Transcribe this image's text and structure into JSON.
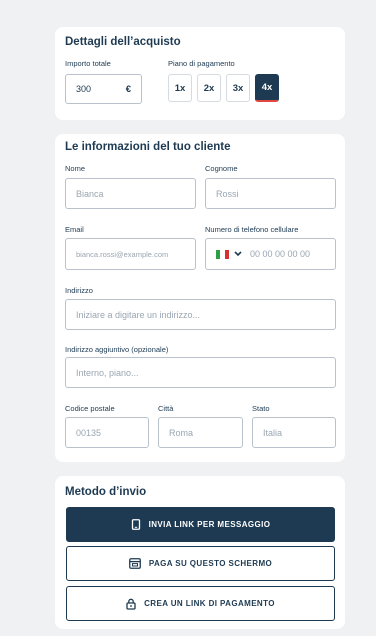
{
  "purchase": {
    "title": "Dettagli dell’acquisto",
    "amount_label": "Importo totale",
    "amount_value": "300",
    "currency": "€",
    "plan_label": "Piano di pagamento",
    "plans": [
      "1x",
      "2x",
      "3x",
      "4x"
    ],
    "selected_plan": "4x"
  },
  "customer": {
    "title": "Le informazioni del tuo cliente",
    "first_name_label": "Nome",
    "first_name_placeholder": "Bianca",
    "last_name_label": "Cognome",
    "last_name_placeholder": "Rossi",
    "email_label": "Email",
    "email_placeholder": "bianca.rossi@example.com",
    "phone_label": "Numero di telefono cellulare",
    "phone_placeholder": "00 00 00 00 00",
    "address_label": "Indirizzo",
    "address_placeholder": "Iniziare a digitare un indirizzo...",
    "address2_label": "Indirizzo aggiuntivo (opzionale)",
    "address2_placeholder": "Interno, piano...",
    "postal_label": "Codice postale",
    "postal_placeholder": "00135",
    "city_label": "Città",
    "city_placeholder": "Roma",
    "state_label": "Stato",
    "state_placeholder": "Italia"
  },
  "send": {
    "title": "Metodo d’invio",
    "sms_label": "INVIA LINK PER MESSAGGIO",
    "screen_label": "PAGA SU QUESTO SCHERMO",
    "link_label": "CREA UN LINK DI PAGAMENTO"
  },
  "colors": {
    "primary": "#1d3a52",
    "accent": "#e0473f",
    "flag": [
      "#2f9e44",
      "#ffffff",
      "#d9302f"
    ]
  },
  "icons": {
    "phone": "phone-icon",
    "screen": "screen-payment-icon",
    "lock": "lock-icon",
    "chevron": "chevron-down-icon",
    "flag": "italy-flag-icon"
  }
}
